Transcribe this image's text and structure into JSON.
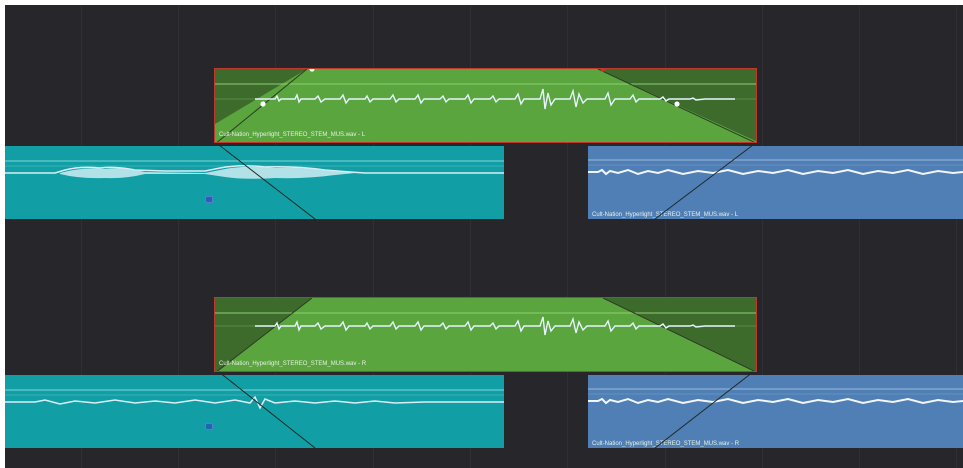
{
  "timeline": {
    "tracks": [
      {
        "crossfade_clip": {
          "label": "Cult-Nation_Hyperlight_STEREO_STEM_MUS.wav - L"
        },
        "left_clip": {
          "label": ""
        },
        "right_clip": {
          "label": "Cult-Nation_Hyperlight_STEREO_STEM_MUS.wav - L"
        }
      },
      {
        "crossfade_clip": {
          "label": "Cult-Nation_Hyperlight_STEREO_STEM_MUS.wav - R"
        },
        "left_clip": {
          "label": ""
        },
        "right_clip": {
          "label": "Cult-Nation_Hyperlight_STEREO_STEM_MUS.wav - R"
        }
      }
    ]
  },
  "colors": {
    "background": "#26262b",
    "crossfade_clip": "#5aa53e",
    "crossfade_border": "#c0392b",
    "left_clip": "#119ea5",
    "right_clip": "#4f7fb4",
    "waveform": "#dbeef5"
  }
}
